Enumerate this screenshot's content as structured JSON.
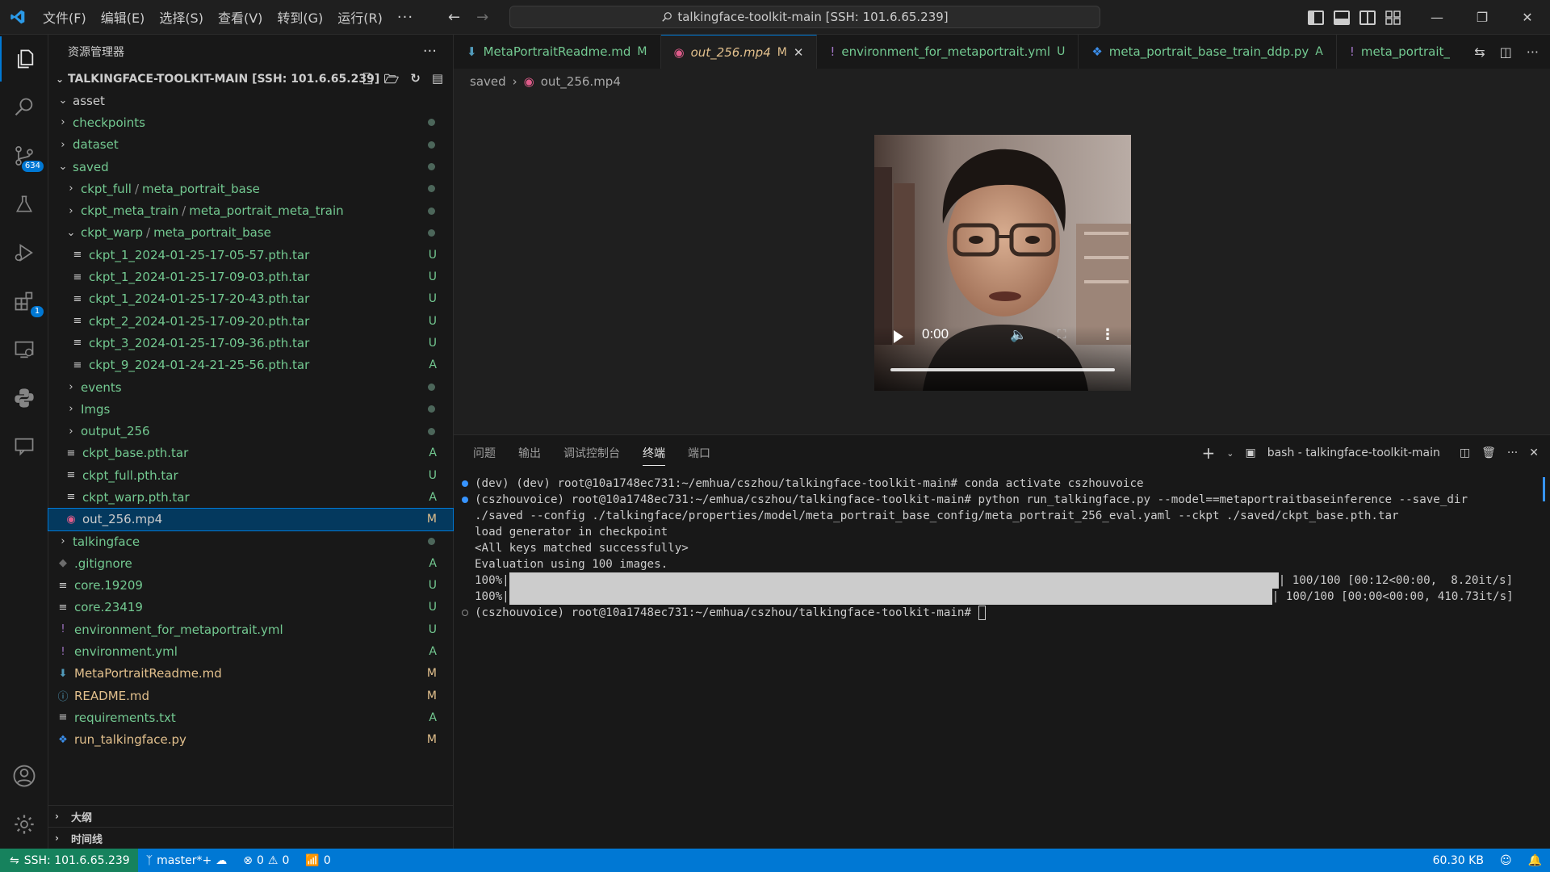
{
  "menubar": {
    "items": [
      "文件(F)",
      "编辑(E)",
      "选择(S)",
      "查看(V)",
      "转到(G)",
      "运行(R)"
    ],
    "more": "···"
  },
  "command_center": {
    "text": "talkingface-toolkit-main [SSH: 101.6.65.239]"
  },
  "activity": {
    "scm_badge": "634",
    "extensions_badge": "1"
  },
  "sidebar": {
    "title": "资源管理器",
    "more": "···",
    "root": "TALKINGFACE-TOOLKIT-MAIN [SSH: 101.6.65.239]",
    "tree": [
      {
        "name": "asset",
        "type": "folder",
        "open": true,
        "level": 1,
        "color": "white",
        "status": ""
      },
      {
        "name": "checkpoints",
        "type": "folder",
        "open": false,
        "level": 1,
        "color": "green",
        "status": "dot"
      },
      {
        "name": "dataset",
        "type": "folder",
        "open": false,
        "level": 1,
        "color": "green",
        "status": "dot"
      },
      {
        "name": "saved",
        "type": "folder",
        "open": true,
        "level": 1,
        "color": "green",
        "status": "dot"
      },
      {
        "name": "ckpt_full",
        "suffix": "meta_portrait_base",
        "type": "folder",
        "open": false,
        "level": 2,
        "color": "green",
        "status": "dot"
      },
      {
        "name": "ckpt_meta_train",
        "suffix": "meta_portrait_meta_train",
        "type": "folder",
        "open": false,
        "level": 2,
        "color": "green",
        "status": "dot"
      },
      {
        "name": "ckpt_warp",
        "suffix": "meta_portrait_base",
        "type": "folder",
        "open": true,
        "level": 2,
        "color": "green",
        "status": "dot"
      },
      {
        "name": "ckpt_1_2024-01-25-17-05-57.pth.tar",
        "type": "file",
        "level": 3,
        "color": "green",
        "status": "U"
      },
      {
        "name": "ckpt_1_2024-01-25-17-09-03.pth.tar",
        "type": "file",
        "level": 3,
        "color": "green",
        "status": "U"
      },
      {
        "name": "ckpt_1_2024-01-25-17-20-43.pth.tar",
        "type": "file",
        "level": 3,
        "color": "green",
        "status": "U"
      },
      {
        "name": "ckpt_2_2024-01-25-17-09-20.pth.tar",
        "type": "file",
        "level": 3,
        "color": "green",
        "status": "U"
      },
      {
        "name": "ckpt_3_2024-01-25-17-09-36.pth.tar",
        "type": "file",
        "level": 3,
        "color": "green",
        "status": "U"
      },
      {
        "name": "ckpt_9_2024-01-24-21-25-56.pth.tar",
        "type": "file",
        "level": 3,
        "color": "green",
        "status": "A"
      },
      {
        "name": "events",
        "type": "folder",
        "open": false,
        "level": 2,
        "color": "green",
        "status": "dot"
      },
      {
        "name": "Imgs",
        "type": "folder",
        "open": false,
        "level": 2,
        "color": "green",
        "status": "dot"
      },
      {
        "name": "output_256",
        "type": "folder",
        "open": false,
        "level": 2,
        "color": "green",
        "status": "dot"
      },
      {
        "name": "ckpt_base.pth.tar",
        "type": "file",
        "level": 2,
        "color": "green",
        "status": "A"
      },
      {
        "name": "ckpt_full.pth.tar",
        "type": "file",
        "level": 2,
        "color": "green",
        "status": "U"
      },
      {
        "name": "ckpt_warp.pth.tar",
        "type": "file",
        "level": 2,
        "color": "green",
        "status": "A"
      },
      {
        "name": "out_256.mp4",
        "type": "video",
        "level": 2,
        "color": "white",
        "status": "M",
        "selected": true
      },
      {
        "name": "talkingface",
        "type": "folder",
        "open": false,
        "level": 1,
        "color": "green",
        "status": "dot"
      },
      {
        "name": ".gitignore",
        "type": "git",
        "level": 1,
        "color": "green",
        "status": "A"
      },
      {
        "name": "core.19209",
        "type": "file",
        "level": 1,
        "color": "green",
        "status": "U"
      },
      {
        "name": "core.23419",
        "type": "file",
        "level": 1,
        "color": "green",
        "status": "U"
      },
      {
        "name": "environment_for_metaportrait.yml",
        "type": "yml",
        "level": 1,
        "color": "green",
        "status": "U"
      },
      {
        "name": "environment.yml",
        "type": "yml",
        "level": 1,
        "color": "green",
        "status": "A"
      },
      {
        "name": "MetaPortraitReadme.md",
        "type": "md",
        "level": 1,
        "color": "mod",
        "status": "M"
      },
      {
        "name": "README.md",
        "type": "info",
        "level": 1,
        "color": "mod",
        "status": "M"
      },
      {
        "name": "requirements.txt",
        "type": "file",
        "level": 1,
        "color": "green",
        "status": "A"
      },
      {
        "name": "run_talkingface.py",
        "type": "py",
        "level": 1,
        "color": "mod",
        "status": "M"
      }
    ],
    "outline": "大纲",
    "timeline": "时间线"
  },
  "tabs": [
    {
      "label": "MetaPortraitReadme.md",
      "status": "M",
      "icon": "md",
      "active": false,
      "color": "#73c991"
    },
    {
      "label": "out_256.mp4",
      "status": "M",
      "icon": "video",
      "active": true,
      "color": "#e2c08d"
    },
    {
      "label": "environment_for_metaportrait.yml",
      "status": "U",
      "icon": "yml",
      "active": false,
      "color": "#73c991"
    },
    {
      "label": "meta_portrait_base_train_ddp.py",
      "status": "A",
      "icon": "py",
      "active": false,
      "color": "#73c991"
    },
    {
      "label": "meta_portrait_",
      "status": "",
      "icon": "yml",
      "active": false,
      "color": "#73c991"
    }
  ],
  "breadcrumb": {
    "folder": "saved",
    "file": "out_256.mp4"
  },
  "video": {
    "time": "0:00",
    "progress": 0
  },
  "panel": {
    "tabs": [
      "问题",
      "输出",
      "调试控制台",
      "终端",
      "端口"
    ],
    "active_tab": "终端",
    "terminal_name": "bash - talkingface-toolkit-main"
  },
  "terminal": {
    "line1": "(dev) (dev) root@10a1748ec731:~/emhua/cszhou/talkingface-toolkit-main# conda activate cszhouvoice",
    "line2": "(cszhouvoice) root@10a1748ec731:~/emhua/cszhou/talkingface-toolkit-main# python run_talkingface.py --model==metaportraitbaseinference --save_dir",
    "line3": "./saved --config ./talkingface/properties/model/meta_portrait_base_config/meta_portrait_256_eval.yaml --ckpt ./saved/ckpt_base.pth.tar",
    "line4": "load generator in checkpoint",
    "line5": "<All keys matched successfully>",
    "line6": "Evaluation using 100 images.",
    "bar1_pct": "100%",
    "bar1_tail": "| 100/100 [00:12<00:00,  8.20it/s]",
    "bar2_pct": "100%",
    "bar2_tail": "| 100/100 [00:00<00:00, 410.73it/s]",
    "prompt": "(cszhouvoice) root@10a1748ec731:~/emhua/cszhou/talkingface-toolkit-main# "
  },
  "statusbar": {
    "remote": "SSH: 101.6.65.239",
    "branch": "master*+",
    "errors": "0",
    "warnings": "0",
    "ports": "0",
    "filesize": "60.30 KB"
  },
  "colors": {
    "accent": "#0078d4",
    "remote": "#16825d",
    "untracked": "#73c991",
    "modified": "#e2c08d"
  }
}
